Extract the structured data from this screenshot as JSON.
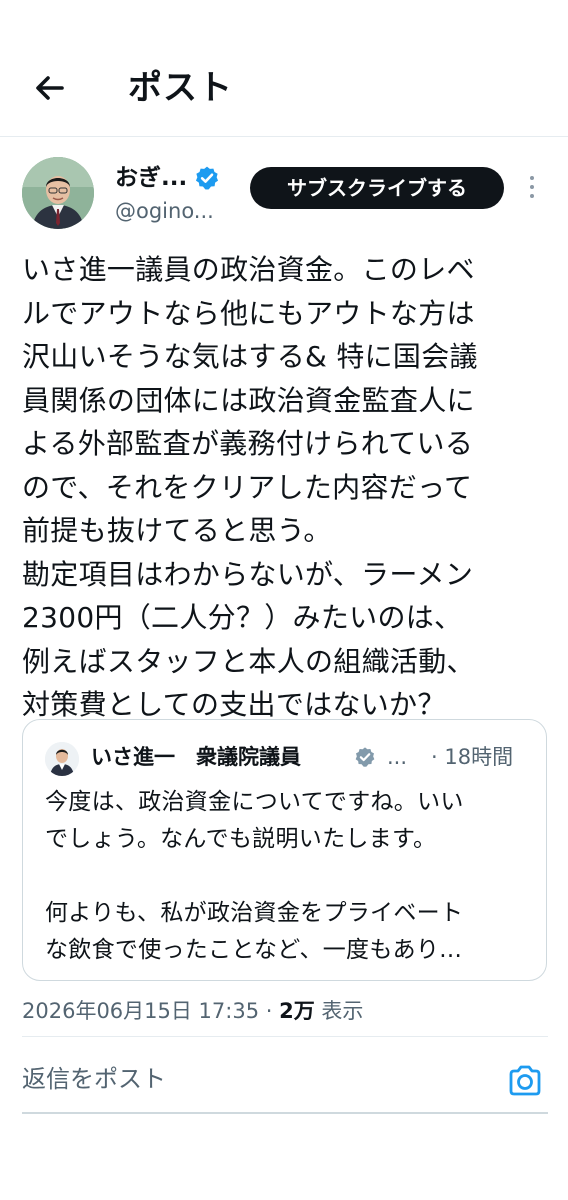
{
  "header": {
    "title": "ポスト",
    "back_icon": "arrow-left-icon"
  },
  "author": {
    "display_name": "おぎ...",
    "handle": "@ogino...",
    "verified": true,
    "verified_color": "#1d9bf0",
    "subscribe_label": "サブスクライブする",
    "more_icon": "more-vertical-icon"
  },
  "post": {
    "text": "いさ進一議員の政治資金。このレベ\nルでアウトなら他にもアウトな方は\n沢山いそうな気はする& 特に国会議\n員関係の団体には政治資金監査人に\nよる外部監査が義務付けられている\nので、それをクリアした内容だって\n前提も抜けてると思う。\n勘定項目はわからないが、ラーメン\n2300円（二人分？）みたいのは、\n例えばスタッフと本人の組織活動、\n対策費としての支出ではないか？"
  },
  "quote": {
    "name": "いさ進一　衆議院議員",
    "verified_color": "#829aab",
    "ellipsis": "...",
    "time": "· 18時間",
    "text": "今度は、政治資金についてですね。いい\nでしょう。なんでも説明いたします。\n\n何よりも、私が政治資金をプライベート\nな飲食で使ったことなど、一度もあり..."
  },
  "meta": {
    "timestamp": "2026年06月15日 17:35 · ",
    "views_count": "2万",
    "views_label": " 表示"
  },
  "reply": {
    "placeholder": "返信をポスト",
    "camera_icon": "camera-icon",
    "accent_color": "#1d9bf0"
  }
}
